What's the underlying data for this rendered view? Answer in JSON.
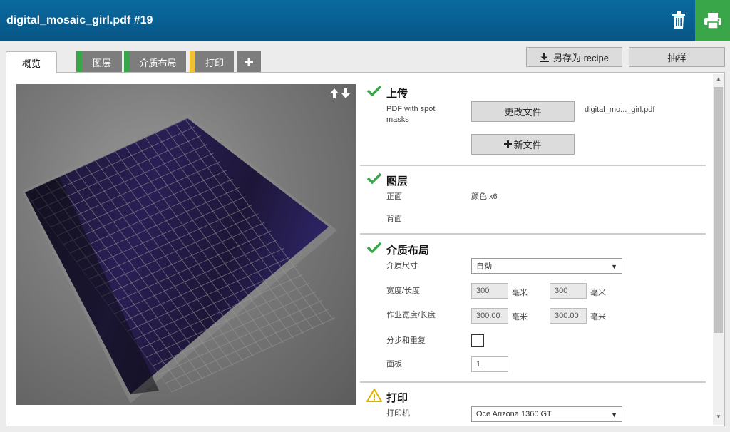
{
  "header": {
    "title": "digital_mosaic_girl.pdf #19",
    "trash_icon": "trash-icon",
    "print_icon": "printer-icon",
    "print_color": "#3aa64a",
    "bar_color": "#0a6aa0"
  },
  "tabs": {
    "overview": "概览",
    "layers": {
      "label": "图层",
      "color": "#3aa64a"
    },
    "media": {
      "label": "介质布局",
      "color": "#3aa64a"
    },
    "print": {
      "label": "打印",
      "color": "#f1c232"
    },
    "add": "+"
  },
  "toolbar": {
    "save_recipe": "另存为 recipe",
    "sample": "抽样"
  },
  "sections": {
    "upload": {
      "title": "上传",
      "status_icon": "check-icon",
      "file_type": "PDF with spot masks",
      "change_file": "更改文件",
      "file_name": "digital_mo..._girl.pdf",
      "new_file": "新文件"
    },
    "layers": {
      "title": "图层",
      "status_icon": "check-icon",
      "front_label": "正面",
      "front_value": "颜色 x6",
      "back_label": "背面"
    },
    "media": {
      "title": "介质布局",
      "status_icon": "check-icon",
      "media_size_label": "介质尺寸",
      "media_size_value": "自动",
      "width_length_label": "宽度/长度",
      "width_value": "300",
      "length_value": "300",
      "unit": "毫米",
      "job_size_label": "作业宽度/长度",
      "job_width_value": "300.00",
      "job_length_value": "300.00",
      "step_repeat_label": "分步和重复",
      "panel_label": "面板",
      "panel_value": "1"
    },
    "print": {
      "title": "打印",
      "status_icon": "warning-icon",
      "printer_label": "打印机",
      "printer_value": "Oce Arizona 1360 GT"
    }
  }
}
